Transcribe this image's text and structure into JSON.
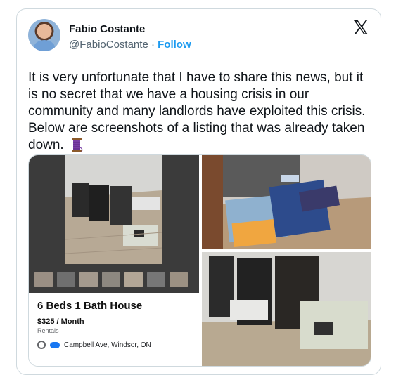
{
  "post": {
    "author_name": "Fabio Costante",
    "author_handle": "@FabioCostante",
    "separator": "·",
    "follow_label": "Follow",
    "text": "It is very unfortunate that I have to share this news, but it is no secret that we have a housing crisis in our community and many landlords have exploited this crisis. Below are screenshots of a listing that was already taken down."
  },
  "listing": {
    "title": "6 Beds 1 Bath House",
    "price": "$325 / Month",
    "category": "Rentals",
    "address": "Campbell Ave, Windsor, ON"
  },
  "icons": {
    "brand": "x-logo-icon",
    "emoji": "thread-spool-icon",
    "location": "location-pin-icon"
  },
  "colors": {
    "link": "#1d9bf0",
    "border": "#cfd9de",
    "text": "#0f1419",
    "muted": "#536471"
  }
}
